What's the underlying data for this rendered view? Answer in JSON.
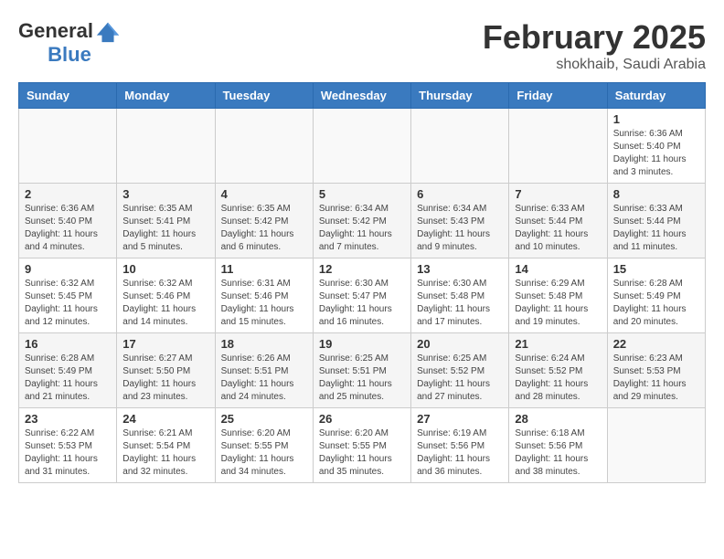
{
  "header": {
    "logo_general": "General",
    "logo_blue": "Blue",
    "main_title": "February 2025",
    "sub_title": "shokhaib, Saudi Arabia"
  },
  "weekdays": [
    "Sunday",
    "Monday",
    "Tuesday",
    "Wednesday",
    "Thursday",
    "Friday",
    "Saturday"
  ],
  "weeks": [
    [
      {
        "day": "",
        "info": ""
      },
      {
        "day": "",
        "info": ""
      },
      {
        "day": "",
        "info": ""
      },
      {
        "day": "",
        "info": ""
      },
      {
        "day": "",
        "info": ""
      },
      {
        "day": "",
        "info": ""
      },
      {
        "day": "1",
        "info": "Sunrise: 6:36 AM\nSunset: 5:40 PM\nDaylight: 11 hours\nand 3 minutes."
      }
    ],
    [
      {
        "day": "2",
        "info": "Sunrise: 6:36 AM\nSunset: 5:40 PM\nDaylight: 11 hours\nand 4 minutes."
      },
      {
        "day": "3",
        "info": "Sunrise: 6:35 AM\nSunset: 5:41 PM\nDaylight: 11 hours\nand 5 minutes."
      },
      {
        "day": "4",
        "info": "Sunrise: 6:35 AM\nSunset: 5:42 PM\nDaylight: 11 hours\nand 6 minutes."
      },
      {
        "day": "5",
        "info": "Sunrise: 6:34 AM\nSunset: 5:42 PM\nDaylight: 11 hours\nand 7 minutes."
      },
      {
        "day": "6",
        "info": "Sunrise: 6:34 AM\nSunset: 5:43 PM\nDaylight: 11 hours\nand 9 minutes."
      },
      {
        "day": "7",
        "info": "Sunrise: 6:33 AM\nSunset: 5:44 PM\nDaylight: 11 hours\nand 10 minutes."
      },
      {
        "day": "8",
        "info": "Sunrise: 6:33 AM\nSunset: 5:44 PM\nDaylight: 11 hours\nand 11 minutes."
      }
    ],
    [
      {
        "day": "9",
        "info": "Sunrise: 6:32 AM\nSunset: 5:45 PM\nDaylight: 11 hours\nand 12 minutes."
      },
      {
        "day": "10",
        "info": "Sunrise: 6:32 AM\nSunset: 5:46 PM\nDaylight: 11 hours\nand 14 minutes."
      },
      {
        "day": "11",
        "info": "Sunrise: 6:31 AM\nSunset: 5:46 PM\nDaylight: 11 hours\nand 15 minutes."
      },
      {
        "day": "12",
        "info": "Sunrise: 6:30 AM\nSunset: 5:47 PM\nDaylight: 11 hours\nand 16 minutes."
      },
      {
        "day": "13",
        "info": "Sunrise: 6:30 AM\nSunset: 5:48 PM\nDaylight: 11 hours\nand 17 minutes."
      },
      {
        "day": "14",
        "info": "Sunrise: 6:29 AM\nSunset: 5:48 PM\nDaylight: 11 hours\nand 19 minutes."
      },
      {
        "day": "15",
        "info": "Sunrise: 6:28 AM\nSunset: 5:49 PM\nDaylight: 11 hours\nand 20 minutes."
      }
    ],
    [
      {
        "day": "16",
        "info": "Sunrise: 6:28 AM\nSunset: 5:49 PM\nDaylight: 11 hours\nand 21 minutes."
      },
      {
        "day": "17",
        "info": "Sunrise: 6:27 AM\nSunset: 5:50 PM\nDaylight: 11 hours\nand 23 minutes."
      },
      {
        "day": "18",
        "info": "Sunrise: 6:26 AM\nSunset: 5:51 PM\nDaylight: 11 hours\nand 24 minutes."
      },
      {
        "day": "19",
        "info": "Sunrise: 6:25 AM\nSunset: 5:51 PM\nDaylight: 11 hours\nand 25 minutes."
      },
      {
        "day": "20",
        "info": "Sunrise: 6:25 AM\nSunset: 5:52 PM\nDaylight: 11 hours\nand 27 minutes."
      },
      {
        "day": "21",
        "info": "Sunrise: 6:24 AM\nSunset: 5:52 PM\nDaylight: 11 hours\nand 28 minutes."
      },
      {
        "day": "22",
        "info": "Sunrise: 6:23 AM\nSunset: 5:53 PM\nDaylight: 11 hours\nand 29 minutes."
      }
    ],
    [
      {
        "day": "23",
        "info": "Sunrise: 6:22 AM\nSunset: 5:53 PM\nDaylight: 11 hours\nand 31 minutes."
      },
      {
        "day": "24",
        "info": "Sunrise: 6:21 AM\nSunset: 5:54 PM\nDaylight: 11 hours\nand 32 minutes."
      },
      {
        "day": "25",
        "info": "Sunrise: 6:20 AM\nSunset: 5:55 PM\nDaylight: 11 hours\nand 34 minutes."
      },
      {
        "day": "26",
        "info": "Sunrise: 6:20 AM\nSunset: 5:55 PM\nDaylight: 11 hours\nand 35 minutes."
      },
      {
        "day": "27",
        "info": "Sunrise: 6:19 AM\nSunset: 5:56 PM\nDaylight: 11 hours\nand 36 minutes."
      },
      {
        "day": "28",
        "info": "Sunrise: 6:18 AM\nSunset: 5:56 PM\nDaylight: 11 hours\nand 38 minutes."
      },
      {
        "day": "",
        "info": ""
      }
    ]
  ]
}
